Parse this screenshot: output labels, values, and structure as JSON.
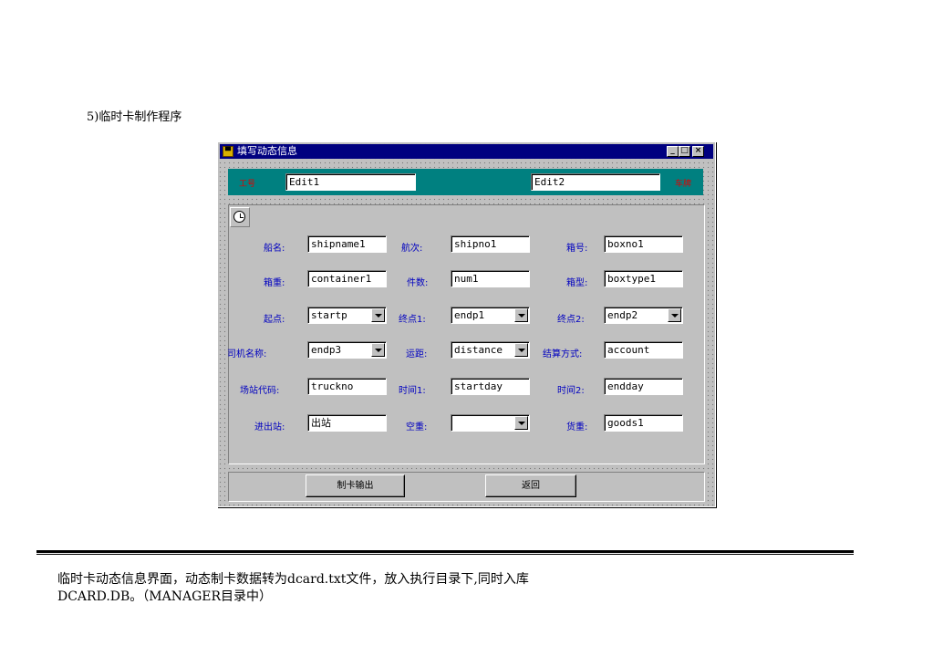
{
  "heading": "5)临时卡制作程序",
  "window": {
    "title": "填写动态信息",
    "min_glyph": "_",
    "max_glyph": "□",
    "close_glyph": "×"
  },
  "top_band": {
    "left_label": "工号",
    "edit1": "Edit1",
    "edit2": "Edit2",
    "right_label": "车牌"
  },
  "fields": {
    "ship_name": {
      "label": "船名:",
      "value": "shipname1"
    },
    "voyage": {
      "label": "航次:",
      "value": "shipno1"
    },
    "box_no": {
      "label": "箱号:",
      "value": "boxno1"
    },
    "box_weight": {
      "label": "箱重:",
      "value": "container1"
    },
    "pieces": {
      "label": "件数:",
      "value": "num1"
    },
    "box_type": {
      "label": "箱型:",
      "value": "boxtype1"
    },
    "start_point": {
      "label": "起点:",
      "value": "startp"
    },
    "end_point1": {
      "label": "终点1:",
      "value": "endp1"
    },
    "end_point2": {
      "label": "终点2:",
      "value": "endp2"
    },
    "driver_name": {
      "label": "司机名称:",
      "value": "endp3"
    },
    "distance": {
      "label": "运距:",
      "value": "distance"
    },
    "settlement": {
      "label": "结算方式:",
      "value": "account"
    },
    "yard_code": {
      "label": "场站代码:",
      "value": "truckno"
    },
    "time1": {
      "label": "时间1:",
      "value": "startday"
    },
    "time2": {
      "label": "时间2:",
      "value": "endday"
    },
    "in_out": {
      "label": "进出站:",
      "value": "出站"
    },
    "empty_heavy": {
      "label": "空重:",
      "value": ""
    },
    "cargo_weight": {
      "label": "货重:",
      "value": "goods1"
    }
  },
  "buttons": {
    "issue_card": "制卡输出",
    "back": "返回"
  },
  "caption": {
    "line1": "临时卡动态信息界面，动态制卡数据转为dcard.txt文件，放入执行目录下,同时入库",
    "line2": "DCARD.DB。（MANAGER目录中）"
  },
  "icons": {
    "app": "app-icon",
    "clock": "clock-icon",
    "dropdown": "chevron-down-icon"
  }
}
